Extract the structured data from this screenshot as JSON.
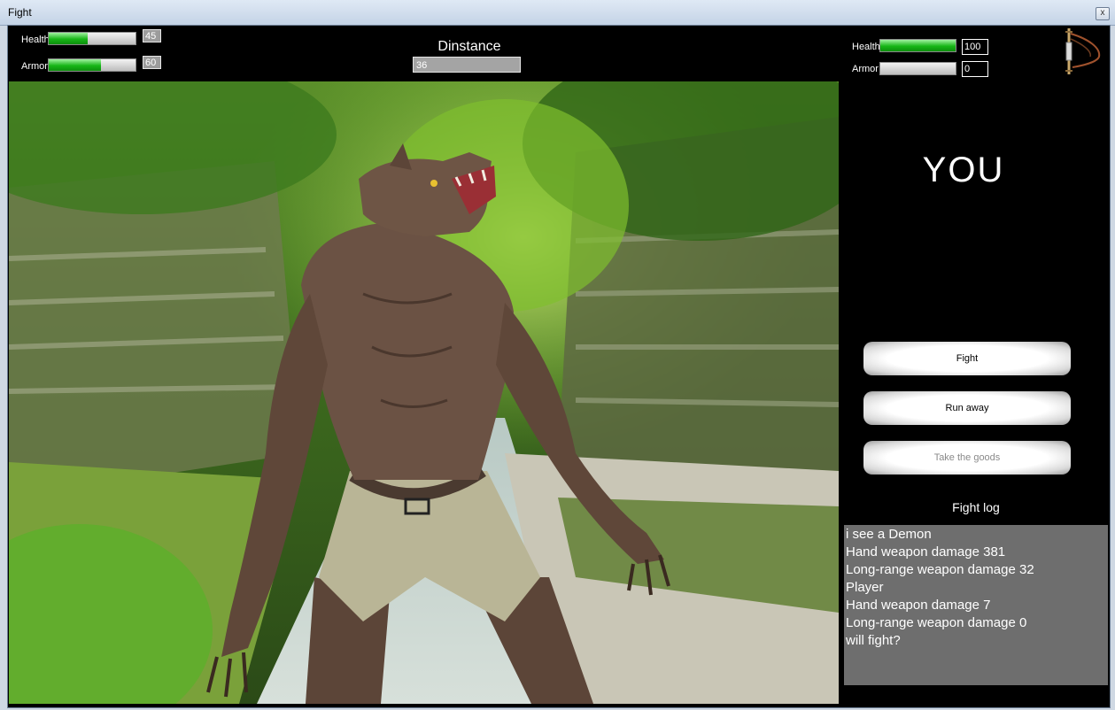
{
  "window": {
    "title": "Fight",
    "close_glyph": "x"
  },
  "enemy_stats": {
    "health": {
      "label": "Health",
      "value": "45",
      "fill_fraction": 0.45
    },
    "armor": {
      "label": "Armor",
      "value": "60",
      "fill_fraction": 0.6
    }
  },
  "distance": {
    "label": "Dinstance",
    "value": "36"
  },
  "player_stats": {
    "health": {
      "label": "Health",
      "value": "100",
      "fill_fraction": 1.0
    },
    "armor": {
      "label": "Armor",
      "value": "0",
      "fill_fraction": 0.0
    }
  },
  "player_panel": {
    "title": "YOU",
    "weapon_icon": "sword-icon"
  },
  "actions": {
    "fight": "Fight",
    "run_away": "Run away",
    "take_goods": "Take the goods"
  },
  "log": {
    "label": "Fight log",
    "lines": [
      "i see a Demon",
      "Hand weapon damage 381",
      "Long-range weapon damage 32",
      "Player",
      "Hand weapon damage 7",
      "Long-range weapon damage 0",
      "will fight?"
    ]
  },
  "colors": {
    "bar_fill": "#17b617",
    "background": "#000000",
    "log_bg": "#6e6e6e"
  }
}
